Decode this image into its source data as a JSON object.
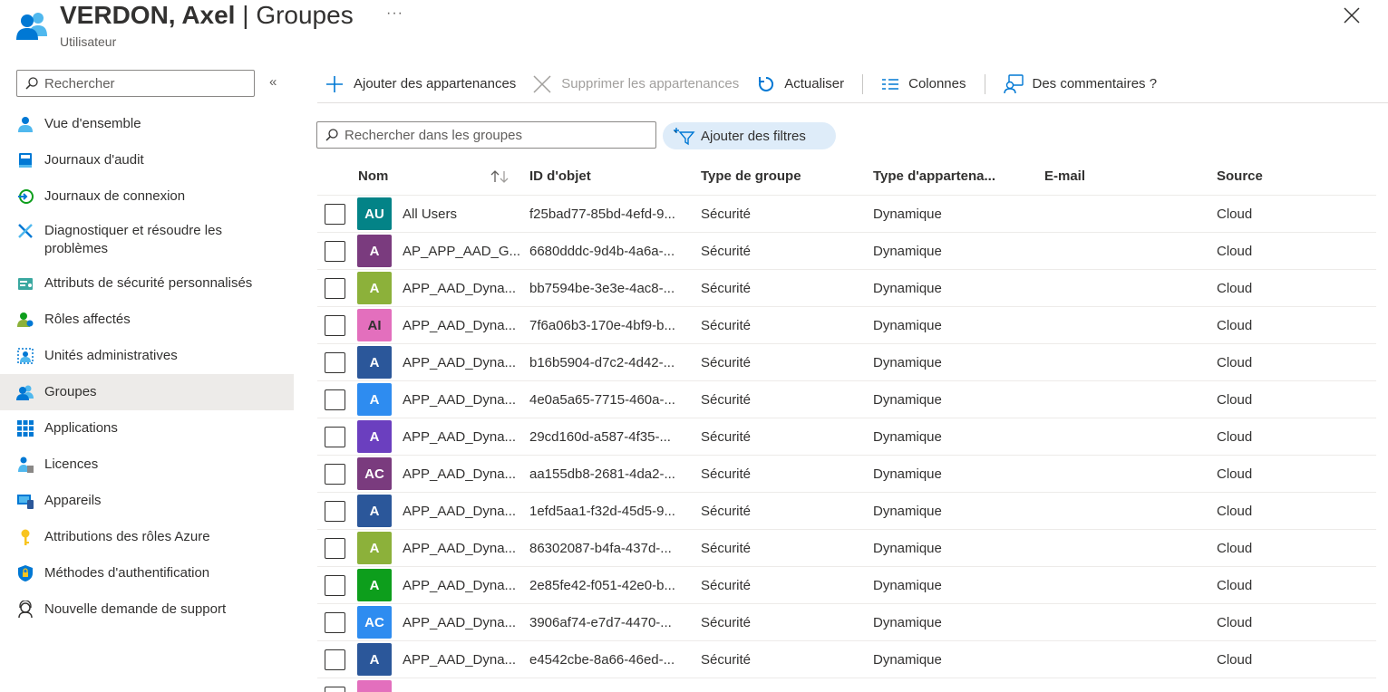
{
  "header": {
    "title_name": "VERDON, Axel",
    "title_sep": " | ",
    "title_page": "Groupes",
    "subtitle": "Utilisateur",
    "more": "···"
  },
  "sidebar": {
    "search_placeholder": "Rechercher",
    "collapse": "«",
    "items": [
      {
        "label": "Vue d'ensemble",
        "icon": "user-icon"
      },
      {
        "label": "Journaux d'audit",
        "icon": "book-icon"
      },
      {
        "label": "Journaux de connexion",
        "icon": "sign-in-icon"
      },
      {
        "label": "Diagnostiquer et résoudre les problèmes",
        "icon": "wrench-icon"
      },
      {
        "label": "Attributs de sécurité personnalisés",
        "icon": "security-attributes-icon"
      },
      {
        "label": "Rôles affectés",
        "icon": "roles-icon"
      },
      {
        "label": "Unités administratives",
        "icon": "admin-units-icon"
      },
      {
        "label": "Groupes",
        "icon": "groups-icon",
        "active": true
      },
      {
        "label": "Applications",
        "icon": "apps-grid-icon"
      },
      {
        "label": "Licences",
        "icon": "license-icon"
      },
      {
        "label": "Appareils",
        "icon": "devices-icon"
      },
      {
        "label": "Attributions des rôles Azure",
        "icon": "key-icon"
      },
      {
        "label": "Méthodes d'authentification",
        "icon": "shield-icon"
      },
      {
        "label": "Nouvelle demande de support",
        "icon": "support-icon"
      }
    ]
  },
  "toolbar": {
    "add": "Ajouter des appartenances",
    "remove": "Supprimer les appartenances",
    "refresh": "Actualiser",
    "columns": "Colonnes",
    "feedback": "Des commentaires ?"
  },
  "filters": {
    "search_placeholder": "Rechercher dans les groupes",
    "add_filters": "Ajouter des filtres"
  },
  "table": {
    "headers": {
      "name": "Nom",
      "object_id": "ID d'objet",
      "group_type": "Type de groupe",
      "membership_type": "Type d'appartena...",
      "email": "E-mail",
      "source": "Source"
    },
    "rows": [
      {
        "initials": "AU",
        "color": "#038387",
        "name": "All Users",
        "id": "f25bad77-85bd-4efd-9...",
        "type": "Sécurité",
        "membership": "Dynamique",
        "email": "",
        "source": "Cloud"
      },
      {
        "initials": "A",
        "color": "#7a3b7e",
        "name": "AP_APP_AAD_G...",
        "id": "6680dddc-9d4b-4a6a-...",
        "type": "Sécurité",
        "membership": "Dynamique",
        "email": "",
        "source": "Cloud"
      },
      {
        "initials": "A",
        "color": "#8cb13a",
        "name": "APP_AAD_Dyna...",
        "id": "bb7594be-3e3e-4ac8-...",
        "type": "Sécurité",
        "membership": "Dynamique",
        "email": "",
        "source": "Cloud"
      },
      {
        "initials": "AI",
        "color": "#e36fbd",
        "name": "APP_AAD_Dyna...",
        "id": "7f6a06b3-170e-4bf9-b...",
        "type": "Sécurité",
        "membership": "Dynamique",
        "email": "",
        "source": "Cloud"
      },
      {
        "initials": "A",
        "color": "#2b579a",
        "name": "APP_AAD_Dyna...",
        "id": "b16b5904-d7c2-4d42-...",
        "type": "Sécurité",
        "membership": "Dynamique",
        "email": "",
        "source": "Cloud"
      },
      {
        "initials": "A",
        "color": "#2e8cf0",
        "name": "APP_AAD_Dyna...",
        "id": "4e0a5a65-7715-460a-...",
        "type": "Sécurité",
        "membership": "Dynamique",
        "email": "",
        "source": "Cloud"
      },
      {
        "initials": "A",
        "color": "#6b3fbf",
        "name": "APP_AAD_Dyna...",
        "id": "29cd160d-a587-4f35-...",
        "type": "Sécurité",
        "membership": "Dynamique",
        "email": "",
        "source": "Cloud"
      },
      {
        "initials": "AC",
        "color": "#7a3b7e",
        "name": "APP_AAD_Dyna...",
        "id": "aa155db8-2681-4da2-...",
        "type": "Sécurité",
        "membership": "Dynamique",
        "email": "",
        "source": "Cloud"
      },
      {
        "initials": "A",
        "color": "#2b579a",
        "name": "APP_AAD_Dyna...",
        "id": "1efd5aa1-f32d-45d5-9...",
        "type": "Sécurité",
        "membership": "Dynamique",
        "email": "",
        "source": "Cloud"
      },
      {
        "initials": "A",
        "color": "#8cb13a",
        "name": "APP_AAD_Dyna...",
        "id": "86302087-b4fa-437d-...",
        "type": "Sécurité",
        "membership": "Dynamique",
        "email": "",
        "source": "Cloud"
      },
      {
        "initials": "A",
        "color": "#0d9e1c",
        "name": "APP_AAD_Dyna...",
        "id": "2e85fe42-f051-42e0-b...",
        "type": "Sécurité",
        "membership": "Dynamique",
        "email": "",
        "source": "Cloud"
      },
      {
        "initials": "AC",
        "color": "#2e8cf0",
        "name": "APP_AAD_Dyna...",
        "id": "3906af74-e7d7-4470-...",
        "type": "Sécurité",
        "membership": "Dynamique",
        "email": "",
        "source": "Cloud"
      },
      {
        "initials": "A",
        "color": "#2b579a",
        "name": "APP_AAD_Dyna...",
        "id": "e4542cbe-8a66-46ed-...",
        "type": "Sécurité",
        "membership": "Dynamique",
        "email": "",
        "source": "Cloud"
      },
      {
        "initials": "",
        "color": "#e36fbd",
        "name": "",
        "id": "",
        "type": "",
        "membership": "",
        "email": "",
        "source": ""
      }
    ]
  },
  "colors": {
    "accent": "#0078d4",
    "active_nav_bg": "#edebe9",
    "filter_pill_bg": "#deecf9"
  }
}
